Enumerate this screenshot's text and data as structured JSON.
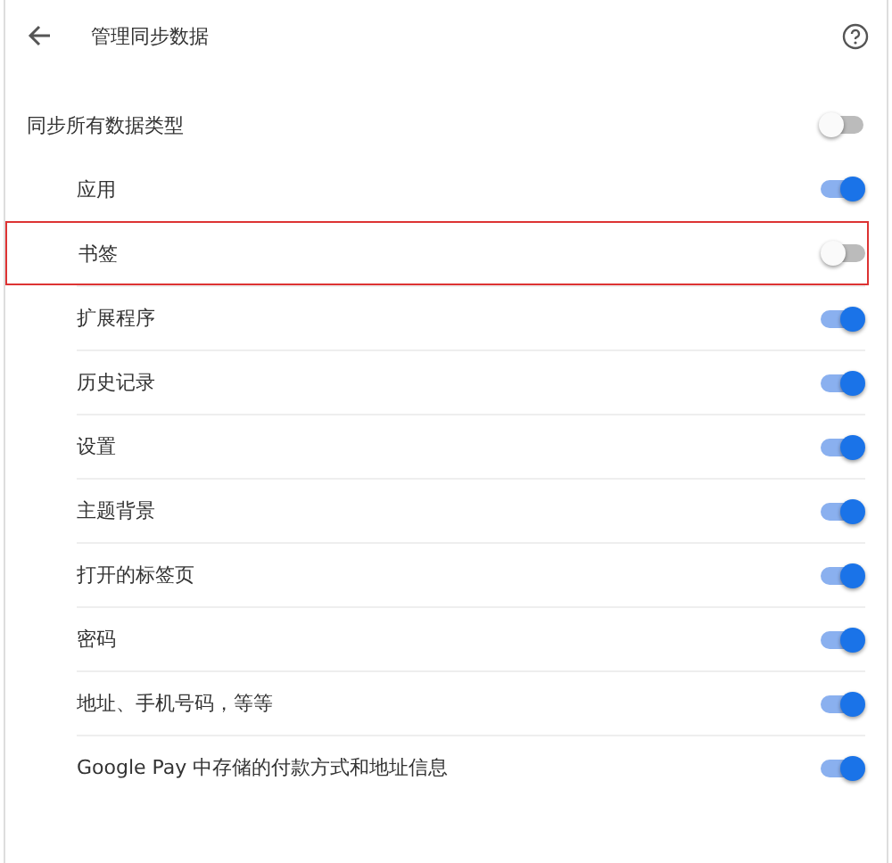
{
  "header": {
    "title": "管理同步数据"
  },
  "sync_all": {
    "label": "同步所有数据类型",
    "on": false
  },
  "items": [
    {
      "label": "应用",
      "on": true,
      "highlighted": false
    },
    {
      "label": "书签",
      "on": false,
      "highlighted": true
    },
    {
      "label": "扩展程序",
      "on": true,
      "highlighted": false
    },
    {
      "label": "历史记录",
      "on": true,
      "highlighted": false
    },
    {
      "label": "设置",
      "on": true,
      "highlighted": false
    },
    {
      "label": "主题背景",
      "on": true,
      "highlighted": false
    },
    {
      "label": "打开的标签页",
      "on": true,
      "highlighted": false
    },
    {
      "label": "密码",
      "on": true,
      "highlighted": false
    },
    {
      "label": "地址、手机号码，等等",
      "on": true,
      "highlighted": false
    },
    {
      "label": "Google Pay 中存储的付款方式和地址信息",
      "on": true,
      "highlighted": false
    }
  ]
}
